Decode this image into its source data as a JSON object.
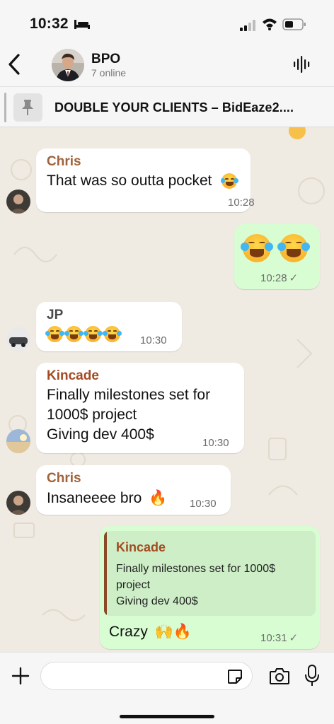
{
  "status_bar": {
    "time": "10:32"
  },
  "header": {
    "title": "BPO",
    "subtitle": "7 online"
  },
  "pinned": {
    "text": "DOUBLE YOUR CLIENTS – BidEaze2...."
  },
  "messages": [
    {
      "sender": "Chris",
      "sender_color": "#a0623a",
      "text": "That was so outta pocket",
      "time": "10:28"
    },
    {
      "time": "10:28"
    },
    {
      "sender": "JP",
      "sender_color": "#4a4a4a",
      "time": "10:30"
    },
    {
      "sender": "Kincade",
      "sender_color": "#a44a22",
      "line1": "Finally milestones set for",
      "line2": "1000$ project",
      "line3": "Giving dev 400$",
      "time": "10:30"
    },
    {
      "sender": "Chris",
      "sender_color": "#a0623a",
      "text": "Insaneeee bro",
      "time": "10:30"
    },
    {
      "quote_sender": "Kincade",
      "quote_line1": "Finally milestones set for 1000$",
      "quote_line2": "project",
      "quote_line3": "Giving dev 400$",
      "text": "Crazy",
      "time": "10:31"
    }
  ],
  "input": {
    "placeholder": ""
  },
  "colors": {
    "incoming": "#ffffff",
    "outgoing": "#d9fdd3",
    "wallpaper": "#efeae2",
    "checkmark": "#777777"
  },
  "icons": [
    "bed-icon",
    "signal-icon",
    "wifi-icon",
    "battery-icon",
    "back-icon",
    "voice-chat-icon",
    "pin-icon",
    "laughing-tears-emoji",
    "fire-emoji",
    "raised-hands-emoji",
    "plus-icon",
    "sticker-icon",
    "camera-icon",
    "mic-icon"
  ]
}
